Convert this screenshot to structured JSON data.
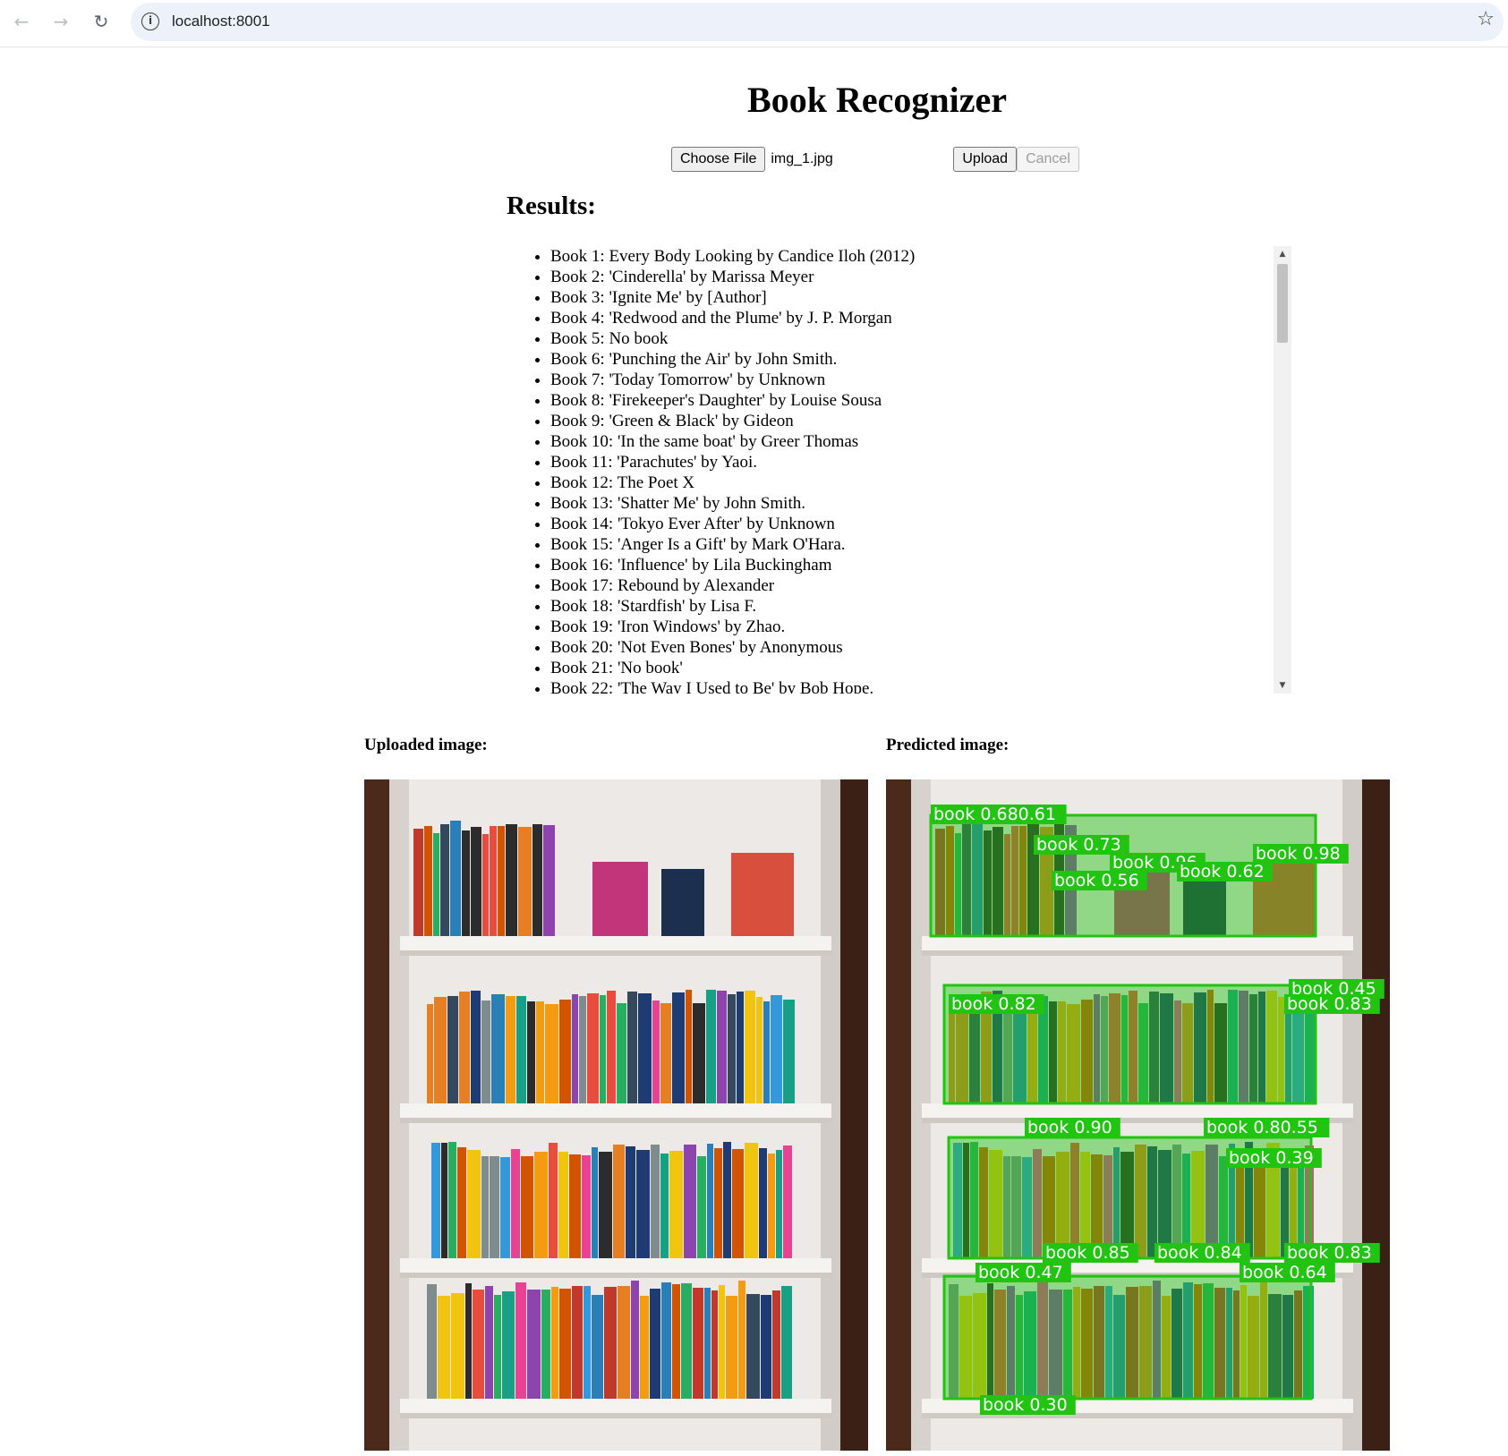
{
  "browser": {
    "url": "localhost:8001",
    "back_icon": "arrow-left",
    "forward_icon": "arrow-right",
    "reload_icon": "reload",
    "info_icon": "info",
    "bookmark_icon": "star"
  },
  "page": {
    "title": "Book Recognizer",
    "choose_file_label": "Choose File",
    "file_name": "img_1.jpg",
    "upload_label": "Upload",
    "cancel_label": "Cancel",
    "results_heading": "Results:",
    "results": [
      "Book 1: Every Body Looking by Candice Iloh (2012)",
      "Book 2: 'Cinderella' by Marissa Meyer",
      "Book 3: 'Ignite Me' by [Author]",
      "Book 4: 'Redwood and the Plume' by J. P. Morgan",
      "Book 5: No book",
      "Book 6: 'Punching the Air' by John Smith.",
      "Book 7: 'Today Tomorrow' by Unknown",
      "Book 8: 'Firekeeper's Daughter' by Louise Sousa",
      "Book 9: 'Green & Black' by Gideon",
      "Book 10: 'In the same boat' by Greer Thomas",
      "Book 11: 'Parachutes' by Yaoi.",
      "Book 12: The Poet X",
      "Book 13: 'Shatter Me' by John Smith.",
      "Book 14: 'Tokyo Ever After' by Unknown",
      "Book 15: 'Anger Is a Gift' by Mark O'Hara.",
      "Book 16: 'Influence' by Lila Buckingham",
      "Book 17: Rebound by Alexander",
      "Book 18: 'Stardfish' by Lisa F.",
      "Book 19: 'Iron Windows' by Zhao.",
      "Book 20: 'Not Even Bones' by Anonymous",
      "Book 21: 'No book'",
      "Book 22: 'The Way I Used to Be' by Bob Hope."
    ],
    "uploaded_label": "Uploaded image:",
    "predicted_label": "Predicted image:"
  },
  "detections": [
    {
      "text": "book 0.680.61"
    },
    {
      "text": "book 0.73"
    },
    {
      "text": "book 0.96"
    },
    {
      "text": "book 0.62"
    },
    {
      "text": "book 0.98"
    },
    {
      "text": "book 0.56"
    },
    {
      "text": "book 0.45"
    },
    {
      "text": "book 0.82"
    },
    {
      "text": "book 0.83"
    },
    {
      "text": "book 0.90"
    },
    {
      "text": "book 0.80.55"
    },
    {
      "text": "book 0.39"
    },
    {
      "text": "book 0.85"
    },
    {
      "text": "book 0.84"
    },
    {
      "text": "book 0.83"
    },
    {
      "text": "book 0.47"
    },
    {
      "text": "book 0.64"
    },
    {
      "text": "book 0.30"
    }
  ],
  "colors": {
    "detection_green": "#22c412",
    "omnibox_bg": "#edf1fa"
  }
}
